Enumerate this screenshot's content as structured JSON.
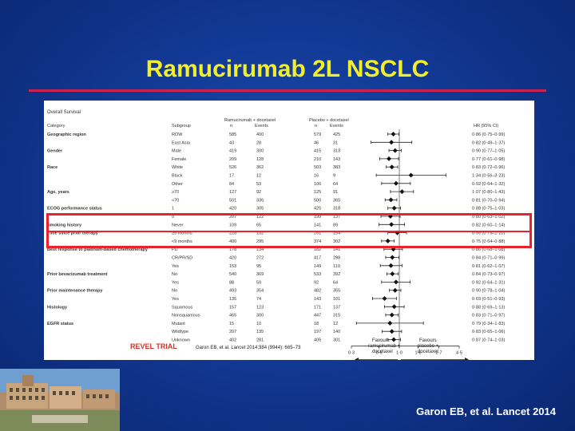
{
  "slide": {
    "title": "Ramucirumab 2L NSCLC",
    "citation": "Garon EB, et al. Lancet 2014"
  },
  "colors": {
    "title": "#f2ef2a",
    "rule": "#c9234e",
    "highlight": "#e8222e",
    "trial": "#c8372d"
  },
  "chart_data": {
    "type": "forest",
    "title": "Overall Survival",
    "arm1": "Ramucirumab + docetaxel",
    "arm2": "Placebo + docetaxel",
    "headers": {
      "category": "Category",
      "subgroup": "Subgroup",
      "n": "n",
      "events": "Events",
      "hr": "HR (95% CI)"
    },
    "rows": [
      {
        "cat": "Geographic region",
        "sub": "ROW",
        "n1": "585",
        "e1": "400",
        "n2": "579",
        "e2": "425",
        "hrText": "0·86 (0·75–0·99)",
        "hr": 0.86,
        "lo": 0.75,
        "hi": 0.99
      },
      {
        "cat": "",
        "sub": "East Asia",
        "n1": "43",
        "e1": "28",
        "n2": "46",
        "e2": "31",
        "hrText": "0·82 (0·49–1·37)",
        "hr": 0.82,
        "lo": 0.49,
        "hi": 1.37
      },
      {
        "cat": "Gender",
        "sub": "Male",
        "n1": "419",
        "e1": "300",
        "n2": "415",
        "e2": "313",
        "hrText": "0·90 (0·77–1·05)",
        "hr": 0.9,
        "lo": 0.77,
        "hi": 1.05
      },
      {
        "cat": "",
        "sub": "Female",
        "n1": "209",
        "e1": "128",
        "n2": "210",
        "e2": "143",
        "hrText": "0·77 (0·61–0·98)",
        "hr": 0.77,
        "lo": 0.61,
        "hi": 0.98
      },
      {
        "cat": "Race",
        "sub": "White",
        "n1": "526",
        "e1": "362",
        "n2": "503",
        "e2": "383",
        "hrText": "0·83 (0·72–0·96)",
        "hr": 0.83,
        "lo": 0.72,
        "hi": 0.96
      },
      {
        "cat": "",
        "sub": "Black",
        "n1": "17",
        "e1": "12",
        "n2": "16",
        "e2": "9",
        "hrText": "1·34 (0·56–3·23)",
        "hr": 1.34,
        "lo": 0.56,
        "hi": 3.23
      },
      {
        "cat": "",
        "sub": "Other",
        "n1": "84",
        "e1": "53",
        "n2": "106",
        "e2": "64",
        "hrText": "0·92 (0·64–1·32)",
        "hr": 0.92,
        "lo": 0.64,
        "hi": 1.32
      },
      {
        "cat": "Age, years",
        "sub": "≥70",
        "n1": "127",
        "e1": "92",
        "n2": "125",
        "e2": "91",
        "hrText": "1·07 (0·80–1·43)",
        "hr": 1.07,
        "lo": 0.8,
        "hi": 1.43
      },
      {
        "cat": "",
        "sub": "<70",
        "n1": "501",
        "e1": "336",
        "n2": "500",
        "e2": "365",
        "hrText": "0·81 (0·70–0·94)",
        "hr": 0.81,
        "lo": 0.7,
        "hi": 0.94
      },
      {
        "cat": "ECOG performance status",
        "sub": "1",
        "n1": "420",
        "e1": "305",
        "n2": "425",
        "e2": "318",
        "hrText": "0·88 (0·75–1·03)",
        "hr": 0.88,
        "lo": 0.75,
        "hi": 1.03
      },
      {
        "cat": "",
        "sub": "0",
        "n1": "207",
        "e1": "122",
        "n2": "199",
        "e2": "137",
        "hrText": "0·80 (0·63–1·02)",
        "hr": 0.8,
        "lo": 0.63,
        "hi": 1.02
      },
      {
        "cat": "Smoking history",
        "sub": "Never",
        "n1": "109",
        "e1": "65",
        "n2": "141",
        "e2": "89",
        "hrText": "0·82 (0·60–1·14)",
        "hr": 0.82,
        "lo": 0.6,
        "hi": 1.14
      },
      {
        "cat": "Time since prior therapy",
        "sub": "≥9 months",
        "n1": "228",
        "e1": "132",
        "n2": "251",
        "e2": "154",
        "hrText": "0·95 (0·75–1·20)",
        "hr": 0.95,
        "lo": 0.75,
        "hi": 1.2
      },
      {
        "cat": "",
        "sub": "<9 months",
        "n1": "400",
        "e1": "295",
        "n2": "374",
        "e2": "302",
        "hrText": "0·75 (0·64–0·88)",
        "hr": 0.75,
        "lo": 0.64,
        "hi": 0.88
      },
      {
        "cat": "Best response to platinum-based chemotherapy",
        "sub": "PD",
        "n1": "178",
        "e1": "134",
        "n2": "182",
        "e2": "141",
        "hrText": "0·86 (0·68–1·08)",
        "hr": 0.86,
        "lo": 0.68,
        "hi": 1.08
      },
      {
        "cat": "",
        "sub": "CR/PR/SD",
        "n1": "420",
        "e1": "272",
        "n2": "417",
        "e2": "298",
        "hrText": "0·84 (0·71–0·99)",
        "hr": 0.84,
        "lo": 0.71,
        "hi": 0.99
      },
      {
        "cat": "",
        "sub": "Yes",
        "n1": "153",
        "e1": "95",
        "n2": "149",
        "e2": "110",
        "hrText": "0·81 (0·62–1·07)",
        "hr": 0.81,
        "lo": 0.62,
        "hi": 1.07
      },
      {
        "cat": "Prior bevacizumab treatment",
        "sub": "No",
        "n1": "540",
        "e1": "369",
        "n2": "533",
        "e2": "392",
        "hrText": "0·84 (0·73–0·97)",
        "hr": 0.84,
        "lo": 0.73,
        "hi": 0.97
      },
      {
        "cat": "",
        "sub": "Yes",
        "n1": "88",
        "e1": "59",
        "n2": "92",
        "e2": "64",
        "hrText": "0·92 (0·64–1·31)",
        "hr": 0.92,
        "lo": 0.64,
        "hi": 1.31
      },
      {
        "cat": "Prior maintenance therapy",
        "sub": "No",
        "n1": "493",
        "e1": "354",
        "n2": "482",
        "e2": "355",
        "hrText": "0·90 (0·78–1·04)",
        "hr": 0.9,
        "lo": 0.78,
        "hi": 1.04
      },
      {
        "cat": "",
        "sub": "Yes",
        "n1": "135",
        "e1": "74",
        "n2": "143",
        "e2": "101",
        "hrText": "0·69 (0·51–0·93)",
        "hr": 0.69,
        "lo": 0.51,
        "hi": 0.93
      },
      {
        "cat": "Histology",
        "sub": "Squamous",
        "n1": "157",
        "e1": "123",
        "n2": "171",
        "e2": "137",
        "hrText": "0·88 (0·69–1·13)",
        "hr": 0.88,
        "lo": 0.69,
        "hi": 1.13
      },
      {
        "cat": "",
        "sub": "Nonsquamous",
        "n1": "465",
        "e1": "300",
        "n2": "447",
        "e2": "315",
        "hrText": "0·83 (0·71–0·97)",
        "hr": 0.83,
        "lo": 0.71,
        "hi": 0.97
      },
      {
        "cat": "EGFR status",
        "sub": "Mutant",
        "n1": "15",
        "e1": "10",
        "n2": "18",
        "e2": "12",
        "hrText": "0·79 (0·34–1·83)",
        "hr": 0.79,
        "lo": 0.34,
        "hi": 1.83
      },
      {
        "cat": "",
        "sub": "Wildtype",
        "n1": "207",
        "e1": "135",
        "n2": "197",
        "e2": "140",
        "hrText": "0·83 (0·65–1·06)",
        "hr": 0.83,
        "lo": 0.65,
        "hi": 1.06
      },
      {
        "cat": "",
        "sub": "Unknown",
        "n1": "402",
        "e1": "281",
        "n2": "405",
        "e2": "301",
        "hrText": "0·87 (0·74–1·03)",
        "hr": 0.87,
        "lo": 0.74,
        "hi": 1.03
      }
    ],
    "xaxis": {
      "ticks": [
        0.3,
        0.6,
        1.0,
        1.6,
        2.7,
        4.5
      ],
      "tickLabels": [
        "0·3",
        "0·6",
        "1·0",
        "1·6",
        "2·7",
        "4·5"
      ],
      "scale": "log",
      "reference": 1.0
    },
    "favours_left": [
      "Favours",
      "ramucirumab +",
      "docetaxel"
    ],
    "favours_right": [
      "Favours",
      "placebo +",
      "docetaxel"
    ],
    "trial_label": "REVEL TRIAL",
    "reference_text": "Garon EB, et al. Lancet 2014;384 (9944): 665–73"
  }
}
